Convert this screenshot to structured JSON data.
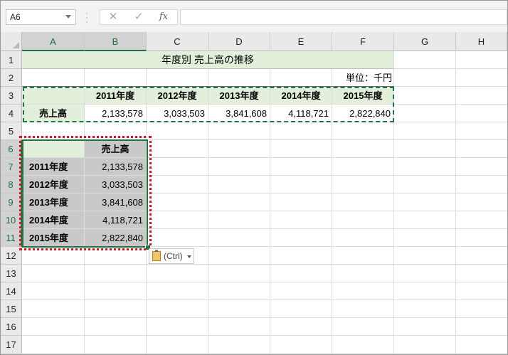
{
  "name_box": "A6",
  "formula_bar": {
    "cancel_icon": "✕",
    "enter_icon": "✓",
    "fx_label": "fx",
    "value": ""
  },
  "columns": [
    "A",
    "B",
    "C",
    "D",
    "E",
    "F",
    "G",
    "H"
  ],
  "rows": [
    "1",
    "2",
    "3",
    "4",
    "5",
    "6",
    "7",
    "8",
    "9",
    "10",
    "11",
    "12",
    "13",
    "14",
    "15",
    "16",
    "17"
  ],
  "sheet": {
    "title": "年度別 売上高の推移",
    "unit": "単位：千円",
    "row3_headers": [
      "2011年度",
      "2012年度",
      "2013年度",
      "2014年度",
      "2015年度"
    ],
    "row4_label": "売上高",
    "row4_values": [
      "2,133,578",
      "3,033,503",
      "3,841,608",
      "4,118,721",
      "2,822,840"
    ],
    "transposed": {
      "header": "売上高",
      "years": [
        "2011年度",
        "2012年度",
        "2013年度",
        "2014年度",
        "2015年度"
      ],
      "values": [
        "2,133,578",
        "3,033,503",
        "3,841,608",
        "4,118,721",
        "2,822,840"
      ]
    }
  },
  "paste_options": {
    "label": "(Ctrl)",
    "icon": "clipboard-icon"
  },
  "colors": {
    "header_fill": "#e2efda",
    "pasted_fill": "#c9c9c9",
    "accent": "#217346",
    "copy_outline": "#e0101a"
  }
}
